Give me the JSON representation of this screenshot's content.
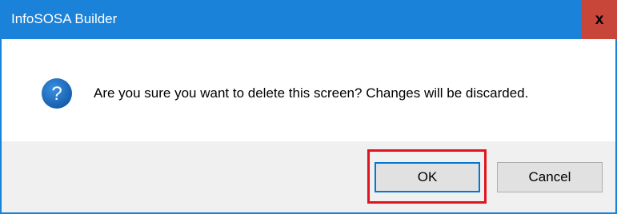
{
  "window": {
    "title": "InfoSOSA Builder",
    "close_label": "x"
  },
  "dialog": {
    "icon": "question-icon",
    "message": "Are you sure you want to delete this screen? Changes will be discarded."
  },
  "buttons": {
    "ok_label": "OK",
    "cancel_label": "Cancel"
  },
  "colors": {
    "titlebar": "#1a82d9",
    "close_button": "#c8453a",
    "highlight": "#e0141e",
    "footer": "#f0f0f0",
    "icon": "#1a6fc9"
  }
}
